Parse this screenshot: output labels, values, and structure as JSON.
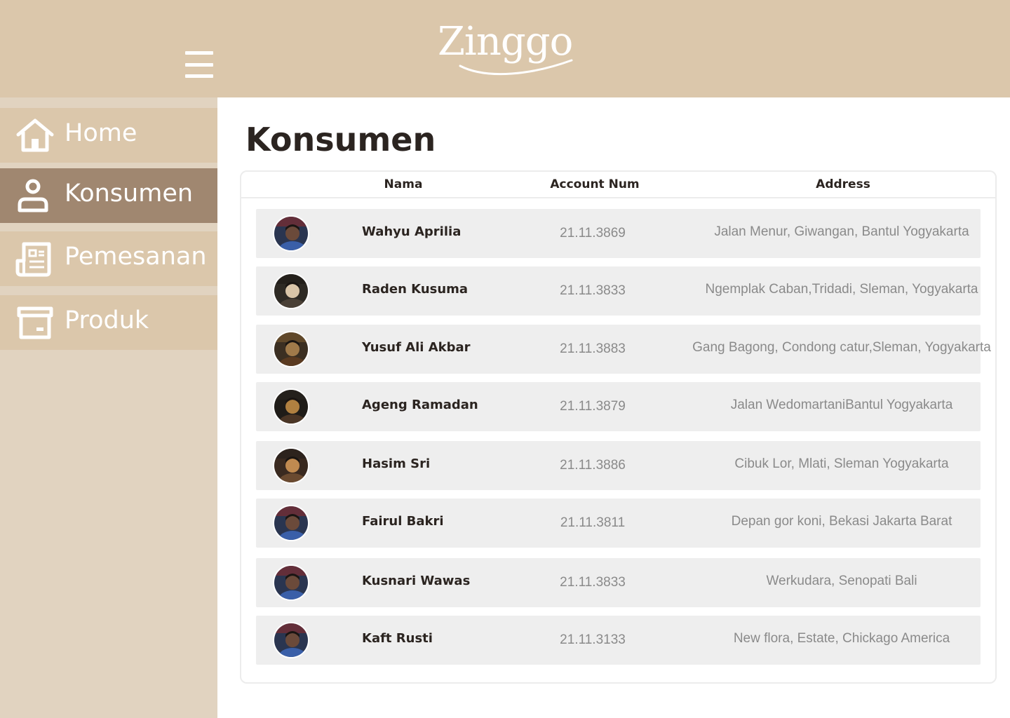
{
  "app": {
    "logo_text": "Zinggo"
  },
  "colors": {
    "header_bg": "#dbc7ab",
    "sidebar_bg": "#e1d3c0",
    "nav_active_bg": "#a08770",
    "row_bg": "#eeeeee"
  },
  "nav": {
    "items": [
      {
        "label": "Home",
        "icon": "home-icon",
        "active": false
      },
      {
        "label": "Konsumen",
        "icon": "user-icon",
        "active": true
      },
      {
        "label": "Pemesanan",
        "icon": "newspaper-icon",
        "active": false
      },
      {
        "label": "Produk",
        "icon": "archive-box-icon",
        "active": false
      }
    ]
  },
  "page": {
    "title": "Konsumen"
  },
  "table": {
    "headers": {
      "name": "Nama",
      "account": "Account Num",
      "address": "Address"
    },
    "rows": [
      {
        "name": "Wahyu Aprilia",
        "account": "21.11.3869",
        "address": "Jalan Menur, Giwangan, Bantul Yogyakarta"
      },
      {
        "name": "Raden Kusuma",
        "account": "21.11.3833",
        "address": "Ngemplak Caban,Tridadi, Sleman, Yogyakarta"
      },
      {
        "name": "Yusuf Ali Akbar",
        "account": "21.11.3883",
        "address": "Gang Bagong, Condong catur,Sleman, Yogyakarta"
      },
      {
        "name": "Ageng Ramadan",
        "account": "21.11.3879",
        "address": "Jalan WedomartaniBantul Yogyakarta"
      },
      {
        "name": "Hasim Sri",
        "account": "21.11.3886",
        "address": "Cibuk Lor, Mlati, Sleman Yogyakarta"
      },
      {
        "name": "Fairul Bakri",
        "account": "21.11.3811",
        "address": "Depan gor koni, Bekasi Jakarta Barat"
      },
      {
        "name": "Kusnari Wawas",
        "account": "21.11.3833",
        "address": "Werkudara, Senopati Bali"
      },
      {
        "name": "Kaft Rusti",
        "account": "21.11.3133",
        "address": "New flora, Estate, Chickago America"
      }
    ]
  }
}
